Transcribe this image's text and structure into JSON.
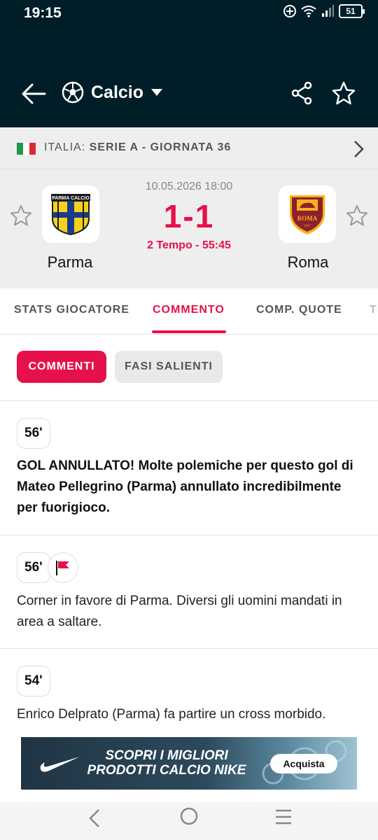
{
  "status": {
    "time": "19:15",
    "battery": "51"
  },
  "appbar": {
    "sport": "Calcio"
  },
  "league": {
    "country": "ITALIA:",
    "name": "SERIE A - GIORNATA 36"
  },
  "match": {
    "date": "10.05.2026 18:00",
    "score": "1-1",
    "time": "2 Tempo - 55:45",
    "home": {
      "name": "Parma",
      "logo_text": "PARMA CALCIO"
    },
    "away": {
      "name": "Roma",
      "logo_text": "ROMA",
      "logo_year": "1927"
    }
  },
  "tabs": [
    {
      "label": "STATS GIOCATORE"
    },
    {
      "label": "COMMENTO"
    },
    {
      "label": "COMP. QUOTE"
    },
    {
      "label": "T"
    }
  ],
  "chips": {
    "active": "COMMENTI",
    "inactive": "FASI SALIENTI"
  },
  "comments": [
    {
      "minute": "56'",
      "text": "GOL ANNULLATO! Molte polemiche per questo gol di Mateo Pellegrino (Parma) annullato incredibilmente per fuorigioco.",
      "icon": "none"
    },
    {
      "minute": "56'",
      "text": "Corner in favore di Parma. Diversi gli uomini mandati in area a saltare.",
      "icon": "corner-flag-icon"
    },
    {
      "minute": "54'",
      "text": "Enrico Delprato (Parma) fa partire un cross morbido.",
      "icon": "none"
    }
  ],
  "ad": {
    "line1": "SCOPRI I MIGLIORI",
    "line2": "PRODOTTI CALCIO NIKE",
    "button": "Acquista"
  },
  "colors": {
    "accent": "#e6114a",
    "header": "#001e28"
  }
}
